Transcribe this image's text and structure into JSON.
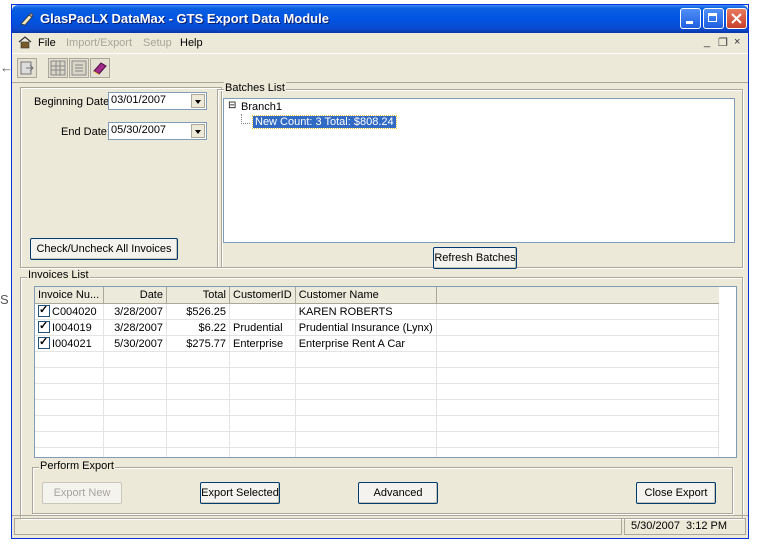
{
  "window": {
    "title": "GlasPacLX DataMax - GTS Export Data Module"
  },
  "menu": {
    "file": "File",
    "import_export": "Import/Export",
    "setup": "Setup",
    "help": "Help",
    "mdi_min": "_",
    "mdi_restore": "❐",
    "mdi_close": "×"
  },
  "background_glyphs": {
    "left_arrow": "←",
    "left_s": "S"
  },
  "dates": {
    "beginning_label": "Beginning Date:",
    "beginning_value": "03/01/2007",
    "end_label": "End Date:",
    "end_value": "05/30/2007"
  },
  "buttons": {
    "check_uncheck": "Check/Uncheck All Invoices",
    "refresh": "Refresh Batches",
    "export_new": "Export New",
    "export_selected": "Export Selected",
    "advanced": "Advanced",
    "close_export": "Close Export"
  },
  "batches": {
    "label": "Batches List",
    "branch_toggle": "⊟",
    "branch": "Branch1",
    "entry": "New Count: 3 Total: $808.24"
  },
  "invoices": {
    "label": "Invoices List",
    "columns": {
      "invoice": "Invoice Nu...",
      "date": "Date",
      "total": "Total",
      "customer_id": "CustomerID",
      "customer_name": "Customer Name"
    },
    "rows": [
      {
        "invoice": "C004020",
        "date": "3/28/2007",
        "total": "$526.25",
        "customer_id": "",
        "customer_name": "KAREN ROBERTS"
      },
      {
        "invoice": "I004019",
        "date": "3/28/2007",
        "total": "$6.22",
        "customer_id": "Prudential",
        "customer_name": "Prudential Insurance (Lynx)"
      },
      {
        "invoice": "I004021",
        "date": "5/30/2007",
        "total": "$275.77",
        "customer_id": "Enterprise",
        "customer_name": "Enterprise Rent A Car"
      }
    ]
  },
  "export": {
    "label": "Perform Export"
  },
  "status": {
    "datetime": "5/30/2007  3:12 PM"
  },
  "colors": {
    "titlebar": "#0054e3",
    "window_face": "#ece9d8",
    "selection": "#316ac5"
  }
}
